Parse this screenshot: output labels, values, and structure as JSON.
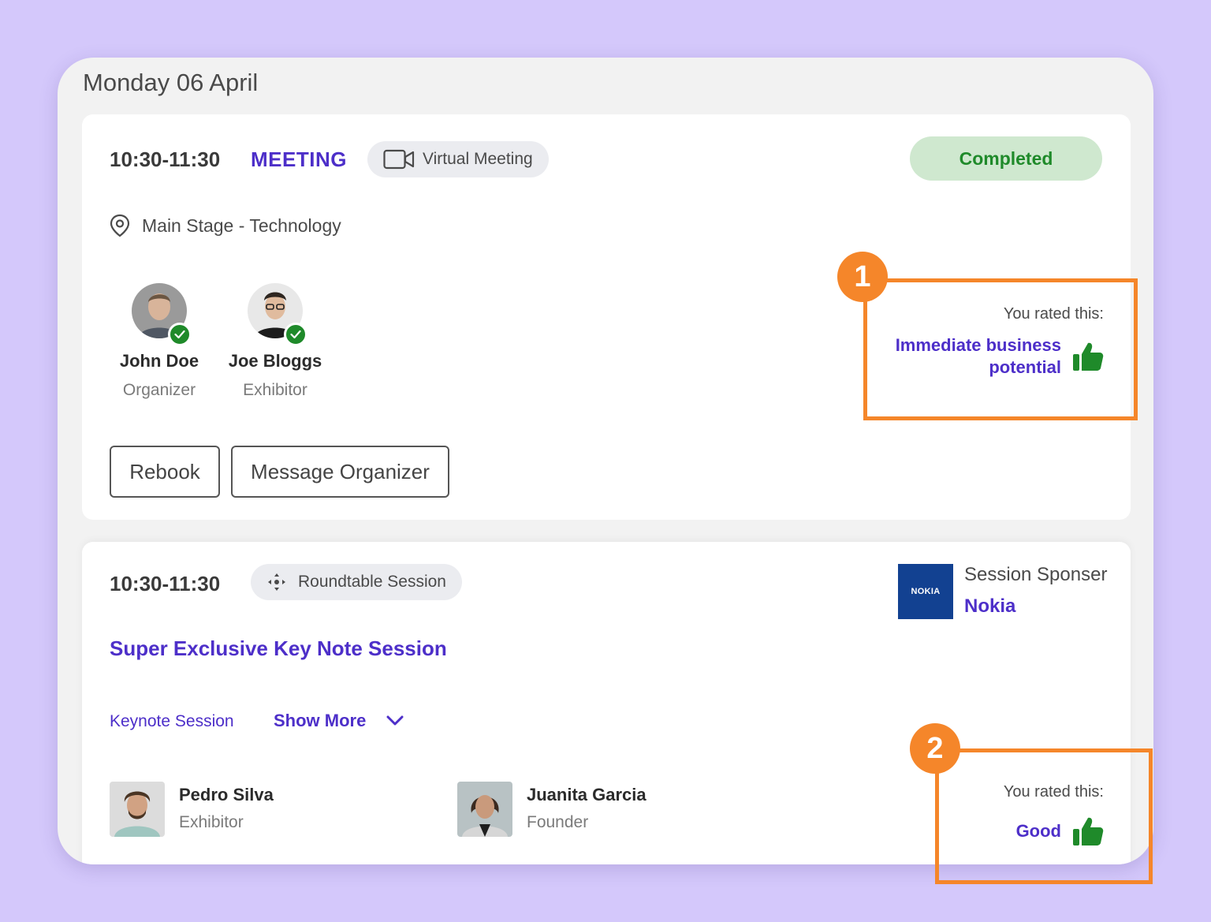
{
  "date_header": "Monday 06 April",
  "meeting": {
    "time": "10:30-11:30",
    "type_label": "MEETING",
    "mode_pill": "Virtual Meeting",
    "status": "Completed",
    "location": "Main Stage - Technology",
    "attendees": [
      {
        "name": "John Doe",
        "role": "Organizer"
      },
      {
        "name": "Joe Bloggs",
        "role": "Exhibitor"
      }
    ],
    "rebook_label": "Rebook",
    "message_label": "Message Organizer",
    "rating_label": "You rated this:",
    "rating_value_line1": "Immediate business",
    "rating_value_line2": "potential"
  },
  "session": {
    "time": "10:30-11:30",
    "mode_pill": "Roundtable Session",
    "sponsor_label": "Session Sponser",
    "sponsor_name": "Nokia",
    "sponsor_logo_text": "NOKIA",
    "title": "Super Exclusive Key Note Session",
    "category_link": "Keynote Session",
    "show_more_label": "Show More",
    "speakers": [
      {
        "name": "Pedro Silva",
        "role": "Exhibitor"
      },
      {
        "name": "Juanita Garcia",
        "role": "Founder"
      }
    ],
    "rating_label": "You rated this:",
    "rating_value": "Good"
  },
  "annotations": {
    "badge_1": "1",
    "badge_2": "2",
    "color": "#f5862a"
  },
  "colors": {
    "accent": "#4d2fc9",
    "success": "#1f8a2a",
    "background": "#d4c8fb"
  }
}
